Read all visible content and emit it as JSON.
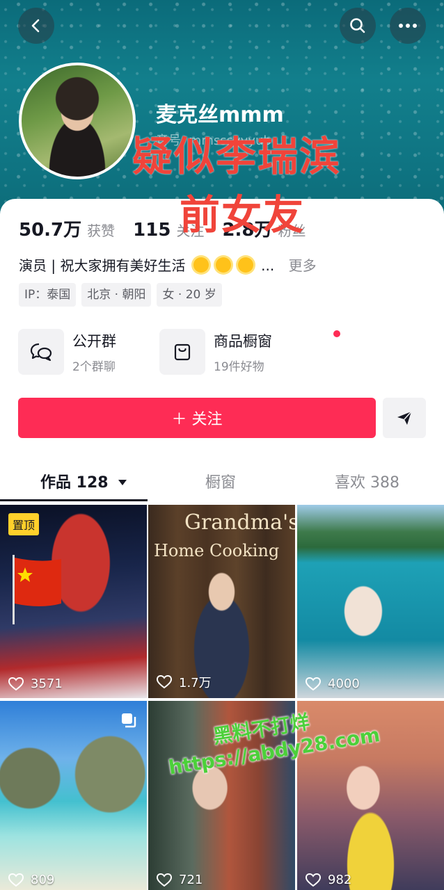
{
  "header": {
    "nickname": "麦克丝mmm",
    "douyin_id_partial": "音号: mmsssyvyub",
    "overlay_line1": "疑似李瑞滨",
    "overlay_line2": "前女友",
    "back_icon": "back-arrow-icon",
    "search_icon": "search-icon",
    "more_icon": "more-dots-icon"
  },
  "stats": [
    {
      "value": "50.7万",
      "label": "获赞"
    },
    {
      "value": "115",
      "label": "关注"
    },
    {
      "value": "2.8万",
      "label": "粉丝"
    }
  ],
  "bio": {
    "text": "演员 | 祝大家拥有美好生活",
    "ellipsis": "...",
    "more": "更多"
  },
  "tags": [
    "IP：泰国",
    "北京 · 朝阳",
    "女 · 20 岁"
  ],
  "entries": [
    {
      "title": "公开群",
      "sub": "2个群聊",
      "icon": "chat-bubbles-icon"
    },
    {
      "title": "商品橱窗",
      "sub": "19件好物",
      "icon": "shopping-bag-icon"
    }
  ],
  "follow_label": "＋ 关注",
  "tabs": [
    {
      "label": "作品 128"
    },
    {
      "label": "橱窗"
    },
    {
      "label": "喜欢 388"
    }
  ],
  "videos": [
    {
      "likes": "3571",
      "pinned_label": "置顶"
    },
    {
      "likes": "1.7万",
      "sign_text_1": "Grandma's",
      "sign_text_2": "Home Cooking"
    },
    {
      "likes": "4000"
    },
    {
      "likes": "809"
    },
    {
      "likes": "721"
    },
    {
      "likes": "982"
    }
  ],
  "watermark": {
    "line1": "黑料不打烊",
    "line2": "https://abdy28.com"
  },
  "colors": {
    "accent": "#fe2c55",
    "overlay_red": "#f0443a",
    "watermark_green": "#4cd03a",
    "pin_yellow": "#ffd02b"
  }
}
